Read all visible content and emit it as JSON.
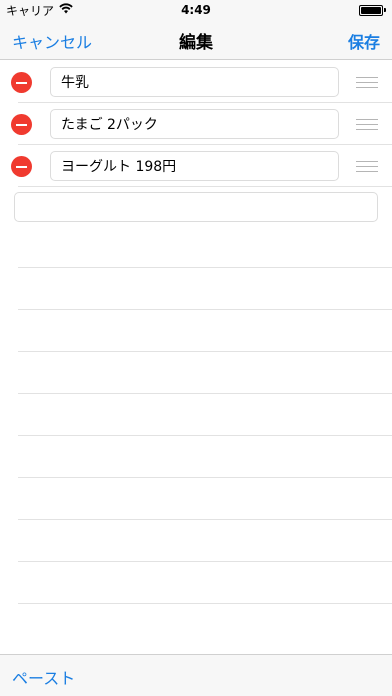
{
  "status": {
    "carrier": "キャリア",
    "time": "4:49"
  },
  "nav": {
    "cancel_label": "キャンセル",
    "title": "編集",
    "save_label": "保存"
  },
  "items": [
    {
      "text": "牛乳"
    },
    {
      "text": "たまご 2パック"
    },
    {
      "text": "ヨーグルト 198円"
    }
  ],
  "toolbar": {
    "paste_label": "ペースト"
  },
  "colors": {
    "accent": "#1a7ee2",
    "delete": "#f03a2f"
  }
}
